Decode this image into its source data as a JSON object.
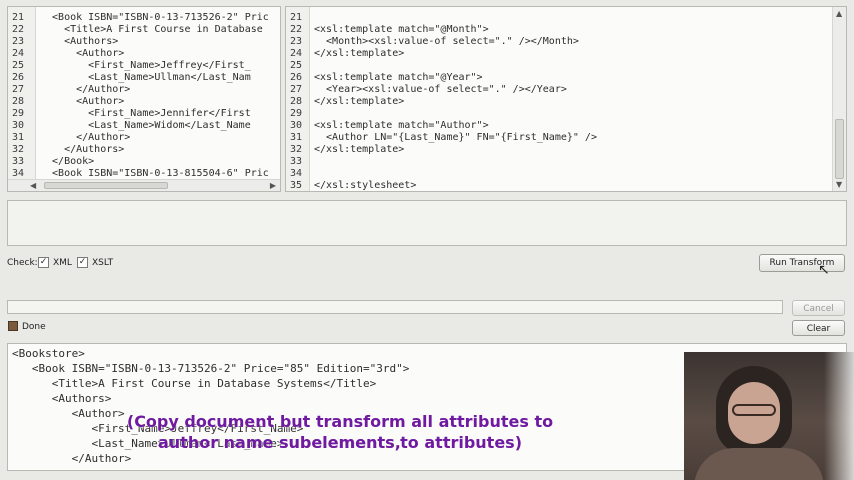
{
  "xml_editor": {
    "lines": [
      {
        "n": "21",
        "text": "  <Book ISBN=\"ISBN-0-13-713526-2\" Pric"
      },
      {
        "n": "22",
        "text": "    <Title>A First Course in Database"
      },
      {
        "n": "23",
        "text": "    <Authors>"
      },
      {
        "n": "24",
        "text": "      <Author>"
      },
      {
        "n": "25",
        "text": "        <First_Name>Jeffrey</First_"
      },
      {
        "n": "26",
        "text": "        <Last_Name>Ullman</Last_Nam"
      },
      {
        "n": "27",
        "text": "      </Author>"
      },
      {
        "n": "28",
        "text": "      <Author>"
      },
      {
        "n": "29",
        "text": "        <First_Name>Jennifer</First"
      },
      {
        "n": "30",
        "text": "        <Last_Name>Widom</Last_Name"
      },
      {
        "n": "31",
        "text": "      </Author>"
      },
      {
        "n": "32",
        "text": "    </Authors>"
      },
      {
        "n": "33",
        "text": "  </Book>"
      },
      {
        "n": "34",
        "text": "  <Book ISBN=\"ISBN-0-13-815504-6\" Pric"
      }
    ]
  },
  "xslt_editor": {
    "lines": [
      {
        "n": "21",
        "text": ""
      },
      {
        "n": "22",
        "text": "<xsl:template match=\"@Month\">"
      },
      {
        "n": "23",
        "text": "  <Month><xsl:value-of select=\".\" /></Month>"
      },
      {
        "n": "24",
        "text": "</xsl:template>"
      },
      {
        "n": "25",
        "text": ""
      },
      {
        "n": "26",
        "text": "<xsl:template match=\"@Year\">"
      },
      {
        "n": "27",
        "text": "  <Year><xsl:value-of select=\".\" /></Year>"
      },
      {
        "n": "28",
        "text": "</xsl:template>"
      },
      {
        "n": "29",
        "text": ""
      },
      {
        "n": "30",
        "text": "<xsl:template match=\"Author\">"
      },
      {
        "n": "31",
        "text": "  <Author LN=\"{Last_Name}\" FN=\"{First_Name}\" />"
      },
      {
        "n": "32",
        "text": "</xsl:template>"
      },
      {
        "n": "33",
        "text": ""
      },
      {
        "n": "34",
        "text": ""
      },
      {
        "n": "35",
        "text": "</xsl:stylesheet>"
      }
    ]
  },
  "check": {
    "label": "Check:",
    "xml_label": "XML",
    "xslt_label": "XSLT",
    "xml_checked": true,
    "xslt_checked": true
  },
  "buttons": {
    "run_transform": "Run Transform",
    "cancel": "Cancel",
    "clear": "Clear"
  },
  "status": {
    "text": "Done"
  },
  "output": {
    "lines": [
      "<Bookstore>",
      "   <Book ISBN=\"ISBN-0-13-713526-2\" Price=\"85\" Edition=\"3rd\">",
      "      <Title>A First Course in Database Systems</Title>",
      "      <Authors>",
      "         <Author>",
      "            <First_Name>Jeffrey</First_Name>",
      "            <Last_Name>Ullman</Last_Name>",
      "         </Author>"
    ]
  },
  "caption": {
    "line1": "(Copy document but transform all attributes to subelements,",
    "line2": "author name subelements to attributes)"
  },
  "colors": {
    "caption": "#6f1aa0",
    "background": "#e9e9e6"
  }
}
